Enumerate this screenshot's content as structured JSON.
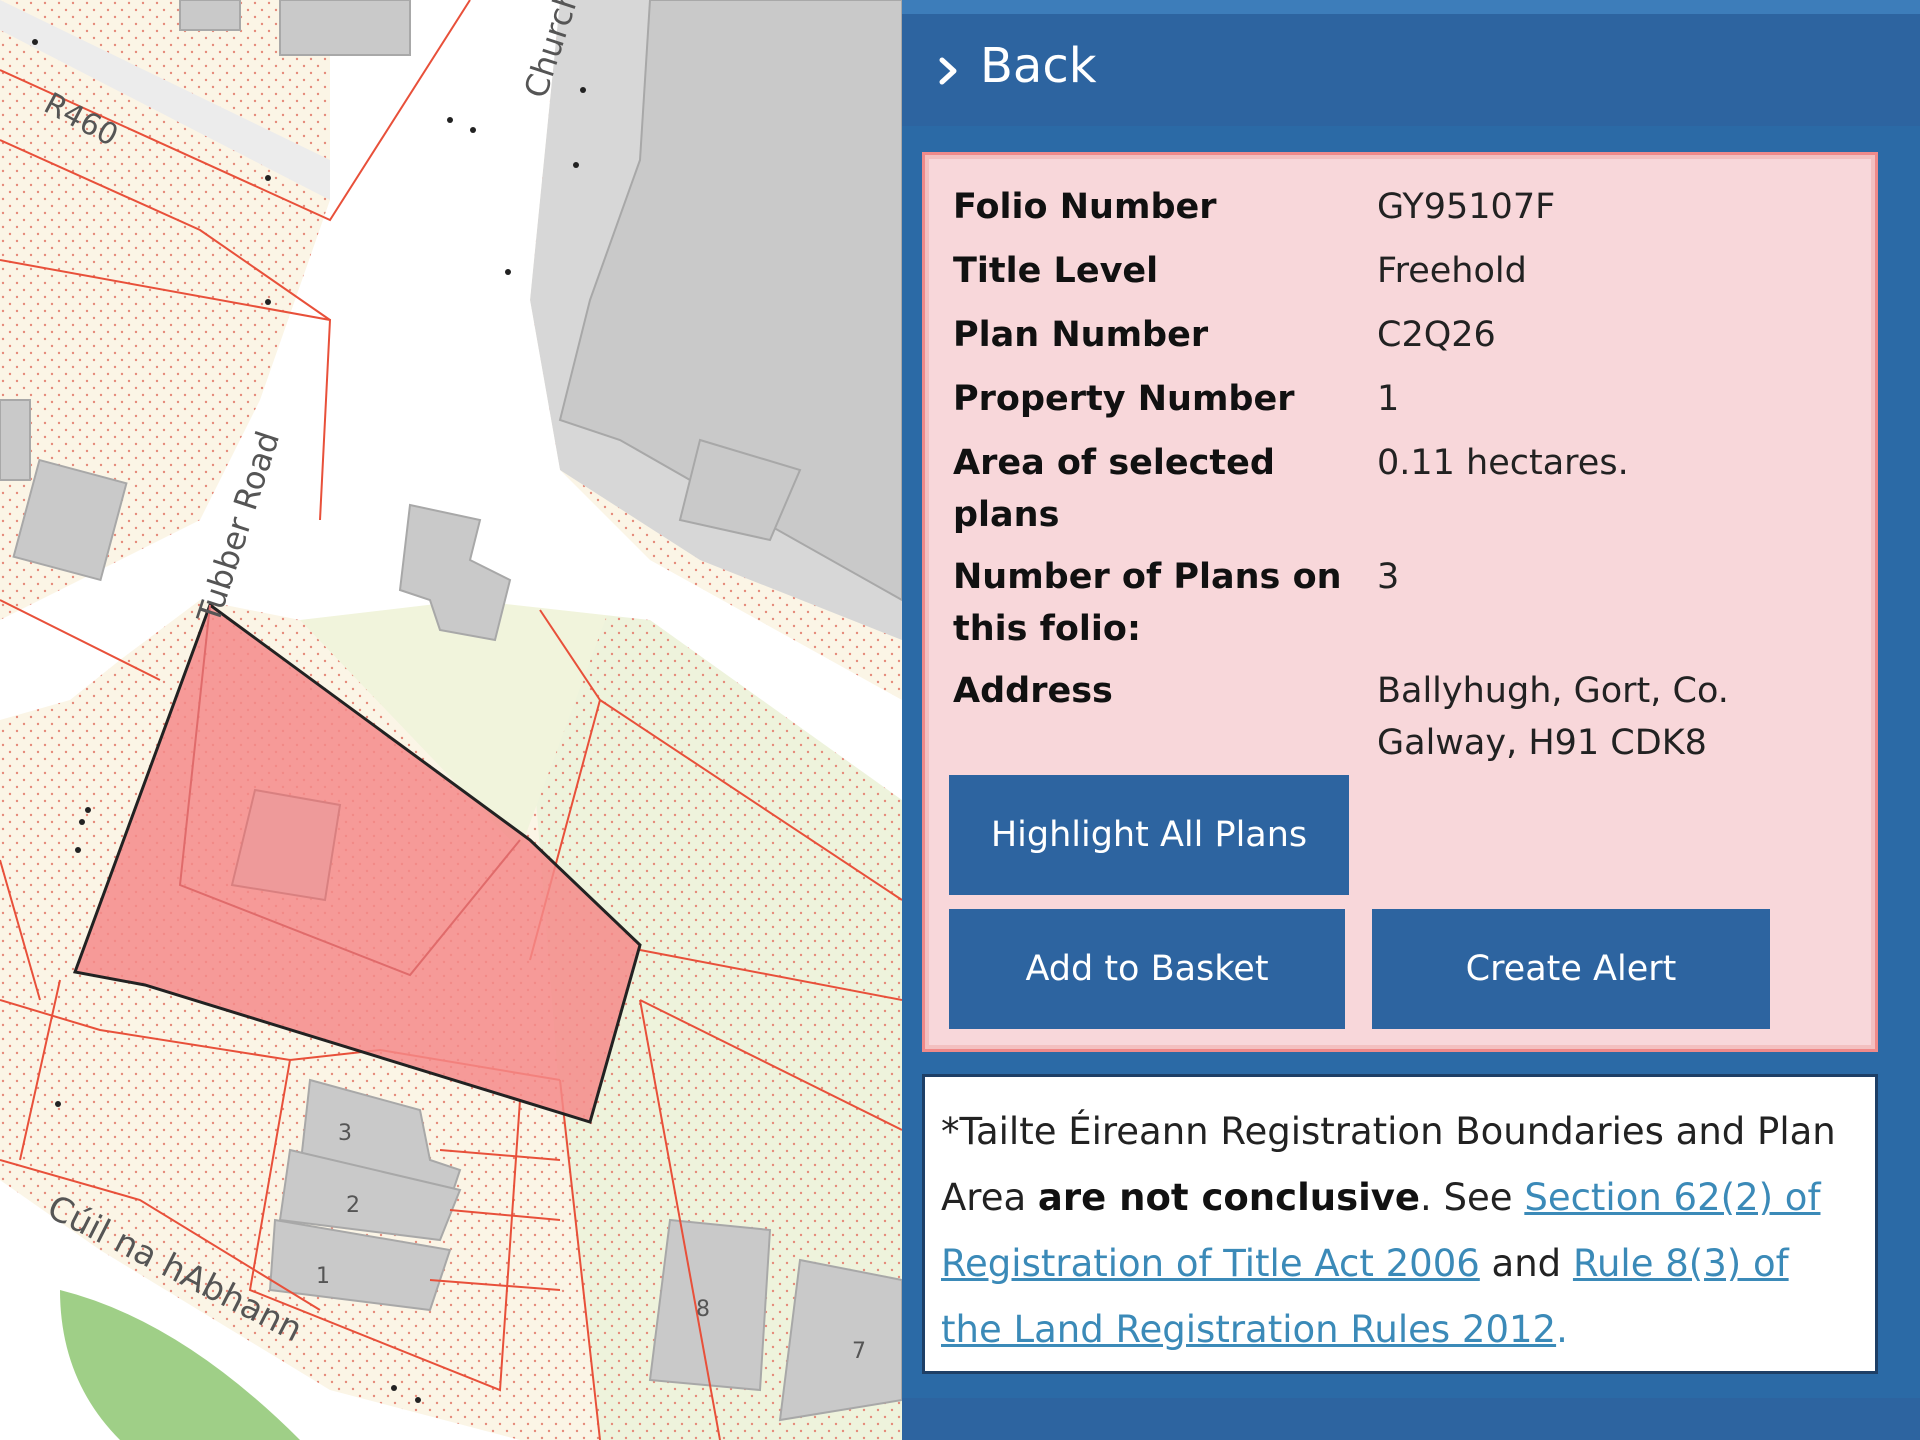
{
  "map": {
    "streets": {
      "r460": "R460",
      "church": "Church",
      "tubber_road": "Tubber Road",
      "cuil_na_habhann": "Cúil na hAbhann"
    },
    "house_numbers": [
      "3",
      "2",
      "1",
      "8",
      "7"
    ],
    "colors": {
      "background": "#fbf5e6",
      "parcel_line": "#e8503a",
      "building": "#c9c9c9",
      "selected_fill": "#f48a8a",
      "road": "#ffffff",
      "green": "#9fcf87"
    }
  },
  "panel": {
    "back_label": "Back",
    "fields": [
      {
        "label": "Folio Number",
        "value": "GY95107F"
      },
      {
        "label": "Title Level",
        "value": "Freehold"
      },
      {
        "label": "Plan Number",
        "value": "C2Q26"
      },
      {
        "label": "Property Number",
        "value": "1"
      },
      {
        "label_line1": "Area of selected",
        "label_line2": "plans",
        "value": "0.11 hectares."
      },
      {
        "label_line1": "Number of Plans on",
        "label_line2": "this folio:",
        "value": "3"
      },
      {
        "label": "Address",
        "value_line1": "Ballyhugh, Gort, Co.",
        "value_line2": "Galway, H91 CDK8"
      }
    ],
    "buttons": {
      "highlight_all": "Highlight All Plans",
      "add_to_basket": "Add to Basket",
      "create_alert": "Create Alert"
    },
    "disclaimer": {
      "prefix": "*Tailte Éireann Registration Boundaries and Plan Area ",
      "bold": "are not conclusive",
      "mid": ". See ",
      "link1": "Section 62(2) of Registration of Title Act 2006",
      "and": " and ",
      "link2": "Rule 8(3) of the Land Registration Rules 2012",
      "suffix": "."
    },
    "colors": {
      "panel_bg": "#2b6aa6",
      "card_bg": "#f8d7da",
      "card_border": "#ef8a8a",
      "button_bg": "#2d64a0",
      "link": "#3b8ab8"
    }
  }
}
